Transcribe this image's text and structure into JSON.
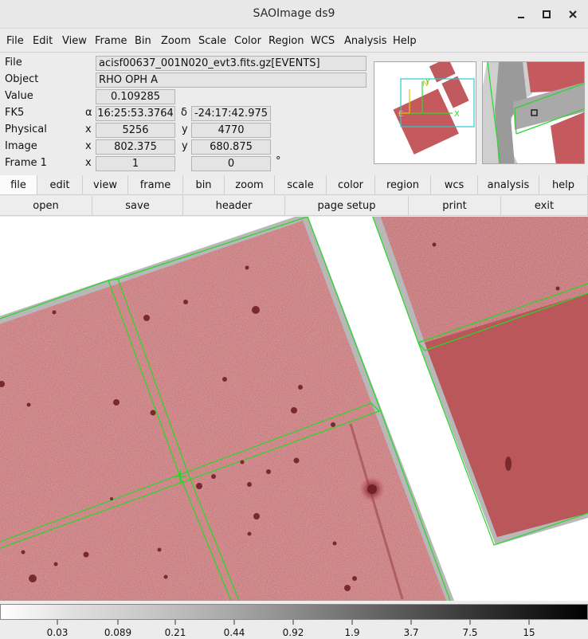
{
  "window": {
    "title": "SAOImage ds9"
  },
  "menubar": [
    "File",
    "Edit",
    "View",
    "Frame",
    "Bin",
    "Zoom",
    "Scale",
    "Color",
    "Region",
    "WCS",
    "Analysis",
    "Help"
  ],
  "info": {
    "file_label": "File",
    "file_value": "acisf00637_001N020_evt3.fits.gz[EVENTS]",
    "object_label": "Object",
    "object_value": "RHO OPH A",
    "value_label": "Value",
    "value_value": "0.109285",
    "fk5_label": "FK5",
    "alpha_symbol": "α",
    "fk5_alpha": "16:25:53.3764",
    "delta_symbol": "δ",
    "fk5_delta": "-24:17:42.975",
    "physical_label": "Physical",
    "physical_x": "5256",
    "physical_y": "4770",
    "image_label": "Image",
    "image_x": "802.375",
    "image_y": "680.875",
    "frame_label": "Frame 1",
    "frame_zoom": "1",
    "frame_angle": "0",
    "x_letter": "x",
    "y_letter": "y",
    "degree_symbol": "°"
  },
  "buttonbar": {
    "top": [
      "file",
      "edit",
      "view",
      "frame",
      "bin",
      "zoom",
      "scale",
      "color",
      "region",
      "wcs",
      "analysis",
      "help"
    ],
    "bottom": [
      "open",
      "save",
      "header",
      "page setup",
      "print",
      "exit"
    ]
  },
  "panner_compass": {
    "north": "N",
    "east": "E",
    "x": "X",
    "y": "Y"
  },
  "colorbar": {
    "labels": [
      "0.03",
      "0.089",
      "0.21",
      "0.44",
      "0.92",
      "1.9",
      "3.7",
      "7.5",
      "15"
    ]
  },
  "colors": {
    "data_red": "#c25a5e",
    "region_green": "#26d826",
    "panner_cyan": "#2bc7d8",
    "compass_yellow": "#e8c400"
  }
}
